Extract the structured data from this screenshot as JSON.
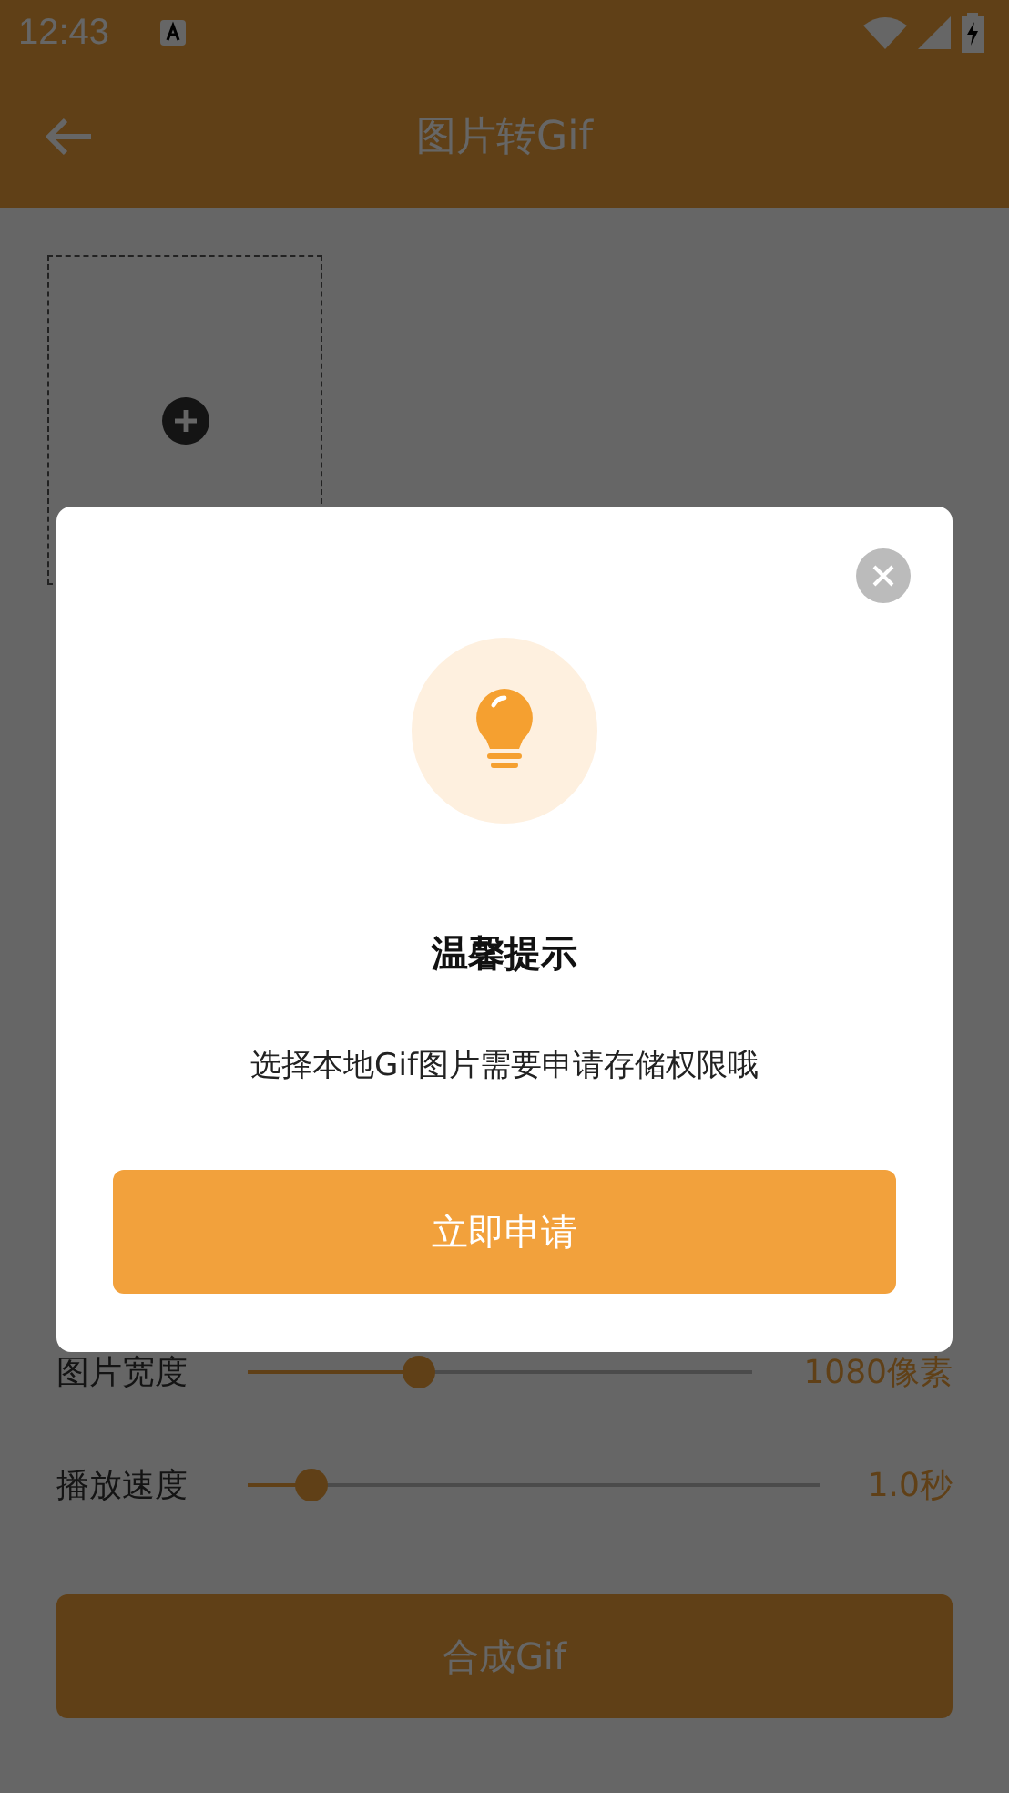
{
  "status_bar": {
    "time": "12:43"
  },
  "app_bar": {
    "title": "图片转Gif"
  },
  "settings": [
    {
      "label": "图片宽度",
      "level": 0.34,
      "reading": "1080像素"
    },
    {
      "label": "播放速度",
      "level": 0.11,
      "reading": "1.0秒"
    }
  ],
  "make_button": "合成Gif",
  "dialog": {
    "title": "温馨提示",
    "message": "选择本地Gif图片需要申请存储权限哦",
    "button": "立即申请"
  }
}
